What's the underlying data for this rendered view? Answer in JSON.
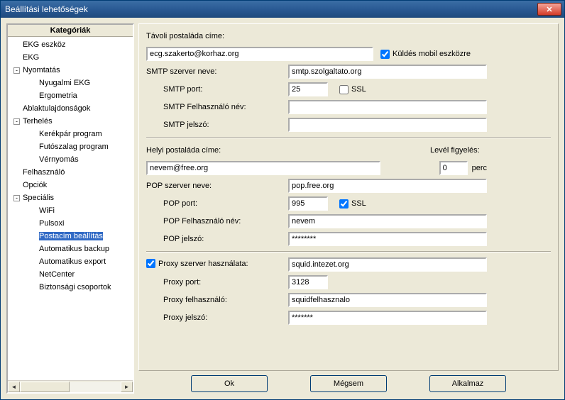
{
  "window": {
    "title": "Beállítási lehetőségek"
  },
  "sidebar": {
    "header": "Kategóriák",
    "items": [
      {
        "label": "EKG eszköz",
        "depth": 1
      },
      {
        "label": "EKG",
        "depth": 1
      },
      {
        "label": "Nyomtatás",
        "depth": 1,
        "toggle": "-"
      },
      {
        "label": "Nyugalmi EKG",
        "depth": 2
      },
      {
        "label": "Ergometria",
        "depth": 2
      },
      {
        "label": "Ablaktulajdonságok",
        "depth": 1
      },
      {
        "label": "Terhelés",
        "depth": 1,
        "toggle": "-"
      },
      {
        "label": "Kerékpár program",
        "depth": 2
      },
      {
        "label": "Futószalag program",
        "depth": 2
      },
      {
        "label": "Vérnyomás",
        "depth": 2
      },
      {
        "label": "Felhasználó",
        "depth": 1
      },
      {
        "label": "Opciók",
        "depth": 1
      },
      {
        "label": "Speciális",
        "depth": 1,
        "toggle": "-"
      },
      {
        "label": "WiFi",
        "depth": 2
      },
      {
        "label": "Pulsoxi",
        "depth": 2
      },
      {
        "label": "Postacím beállítás",
        "depth": 2,
        "selected": true
      },
      {
        "label": "Automatikus backup",
        "depth": 2
      },
      {
        "label": "Automatikus export",
        "depth": 2
      },
      {
        "label": "NetCenter",
        "depth": 2
      },
      {
        "label": "Biztonsági csoportok",
        "depth": 2
      }
    ]
  },
  "form": {
    "remote_label": "Távoli postaláda címe:",
    "remote_value": "ecg.szakerto@korhaz.org",
    "send_mobile_label": "Küldés mobil eszközre",
    "send_mobile_checked": true,
    "smtp_server_label": "SMTP szerver neve:",
    "smtp_server_value": "smtp.szolgaltato.org",
    "smtp_port_label": "SMTP port:",
    "smtp_port_value": "25",
    "smtp_ssl_label": "SSL",
    "smtp_ssl_checked": false,
    "smtp_user_label": "SMTP Felhasználó név:",
    "smtp_user_value": "",
    "smtp_pass_label": "SMTP jelszó:",
    "smtp_pass_value": "",
    "local_label": "Helyi postaláda címe:",
    "local_value": "nevem@free.org",
    "mail_watch_label": "Levél figyelés:",
    "mail_watch_value": "0",
    "mail_watch_unit": "perc",
    "pop_server_label": "POP szerver neve:",
    "pop_server_value": "pop.free.org",
    "pop_port_label": "POP port:",
    "pop_port_value": "995",
    "pop_ssl_label": "SSL",
    "pop_ssl_checked": true,
    "pop_user_label": "POP Felhasználó név:",
    "pop_user_value": "nevem",
    "pop_pass_label": "POP jelszó:",
    "pop_pass_value": "********",
    "proxy_use_label": "Proxy szerver használata:",
    "proxy_use_checked": true,
    "proxy_server_value": "squid.intezet.org",
    "proxy_port_label": "Proxy port:",
    "proxy_port_value": "3128",
    "proxy_user_label": "Proxy felhasználó:",
    "proxy_user_value": "squidfelhasznalo",
    "proxy_pass_label": "Proxy jelszó:",
    "proxy_pass_value": "*******"
  },
  "buttons": {
    "ok": "Ok",
    "cancel": "Mégsem",
    "apply": "Alkalmaz"
  }
}
